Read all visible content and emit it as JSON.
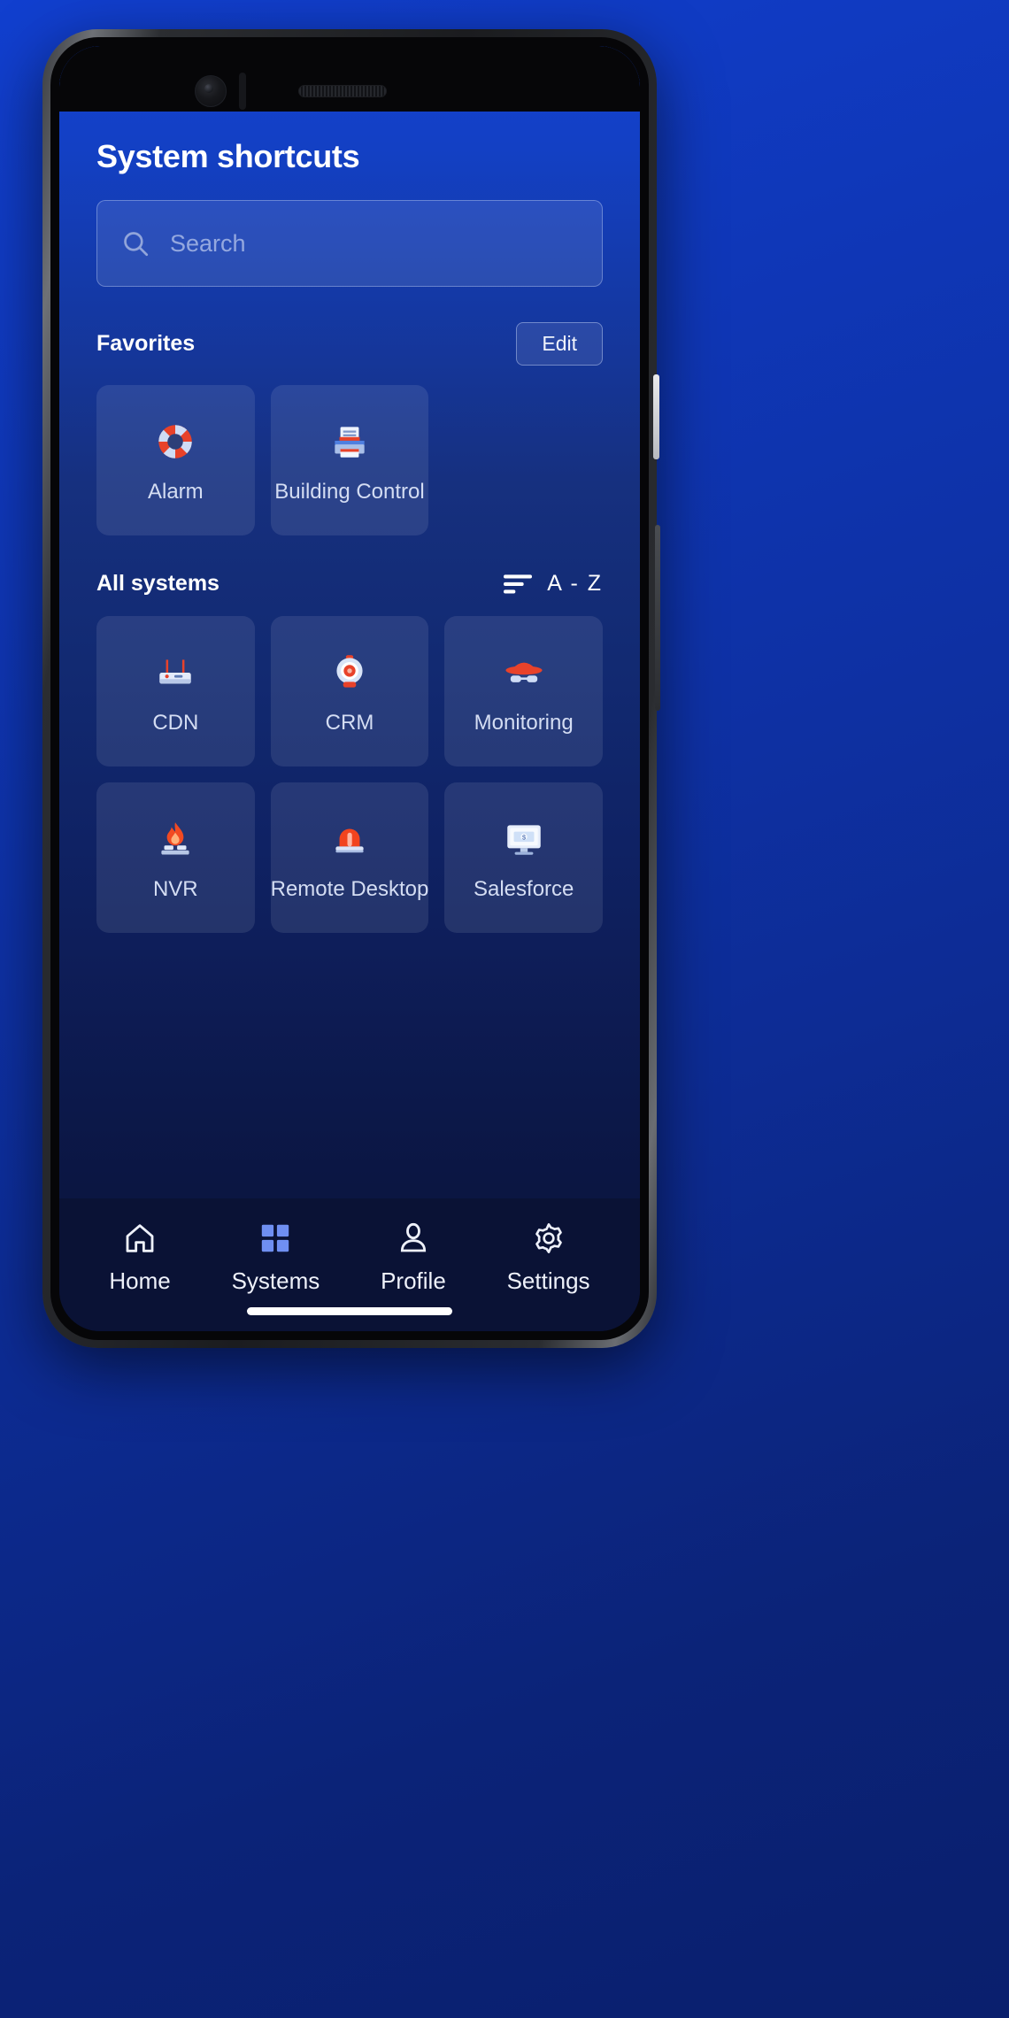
{
  "header": {
    "title": "System shortcuts"
  },
  "search": {
    "placeholder": "Search",
    "value": "",
    "icon": "search-icon"
  },
  "favorites": {
    "title": "Favorites",
    "edit_label": "Edit",
    "items": [
      {
        "label": "Alarm",
        "icon": "lifebuoy-icon"
      },
      {
        "label": "Building Control",
        "icon": "printer-icon"
      }
    ]
  },
  "all_systems": {
    "title": "All systems",
    "sort_label": "A - Z",
    "sort_icon": "sort-descending-icon",
    "items": [
      {
        "label": "CDN",
        "icon": "router-icon"
      },
      {
        "label": "CRM",
        "icon": "webcam-icon"
      },
      {
        "label": "Monitoring",
        "icon": "detective-hat-icon"
      },
      {
        "label": "NVR",
        "icon": "firewall-flame-icon"
      },
      {
        "label": "Remote Desktop",
        "icon": "siren-icon"
      },
      {
        "label": "Salesforce",
        "icon": "monitor-money-icon"
      }
    ]
  },
  "bottom_nav": {
    "items": [
      {
        "label": "Home",
        "icon": "home-icon",
        "active": false
      },
      {
        "label": "Systems",
        "icon": "grid-icon",
        "active": true
      },
      {
        "label": "Profile",
        "icon": "person-icon",
        "active": false
      },
      {
        "label": "Settings",
        "icon": "gear-icon",
        "active": false
      }
    ]
  },
  "colors": {
    "accent": "#6b8cf0",
    "background_top": "#1342cf",
    "background_bottom": "#0a1238",
    "nav_background": "#0a1235",
    "card_surface": "rgba(255,255,255,0.095)",
    "icon_red": "#ee3b22",
    "icon_light": "#cdd9f3"
  }
}
